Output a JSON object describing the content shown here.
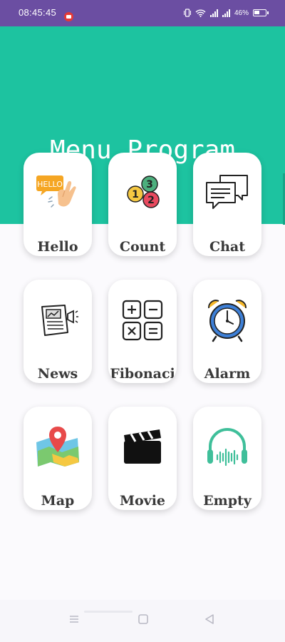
{
  "status_bar": {
    "time": "08:45:45",
    "battery": "46%"
  },
  "header": {
    "title": "Menu Program",
    "background_color": "#1dc3a0"
  },
  "menu": {
    "items": [
      {
        "label": "Hello",
        "icon": "hello-wave-icon"
      },
      {
        "label": "Count",
        "icon": "count-bubbles-icon"
      },
      {
        "label": "Chat",
        "icon": "chat-bubbles-icon"
      },
      {
        "label": "News",
        "icon": "newspaper-icon"
      },
      {
        "label": "Fibonaci",
        "icon": "calculator-icon"
      },
      {
        "label": "Alarm",
        "icon": "alarm-clock-icon"
      },
      {
        "label": "Map",
        "icon": "map-pin-icon"
      },
      {
        "label": "Movie",
        "icon": "clapperboard-icon"
      },
      {
        "label": "Empty",
        "icon": "headphones-icon"
      }
    ]
  },
  "nav": {
    "buttons": [
      "menu",
      "home",
      "back"
    ]
  }
}
